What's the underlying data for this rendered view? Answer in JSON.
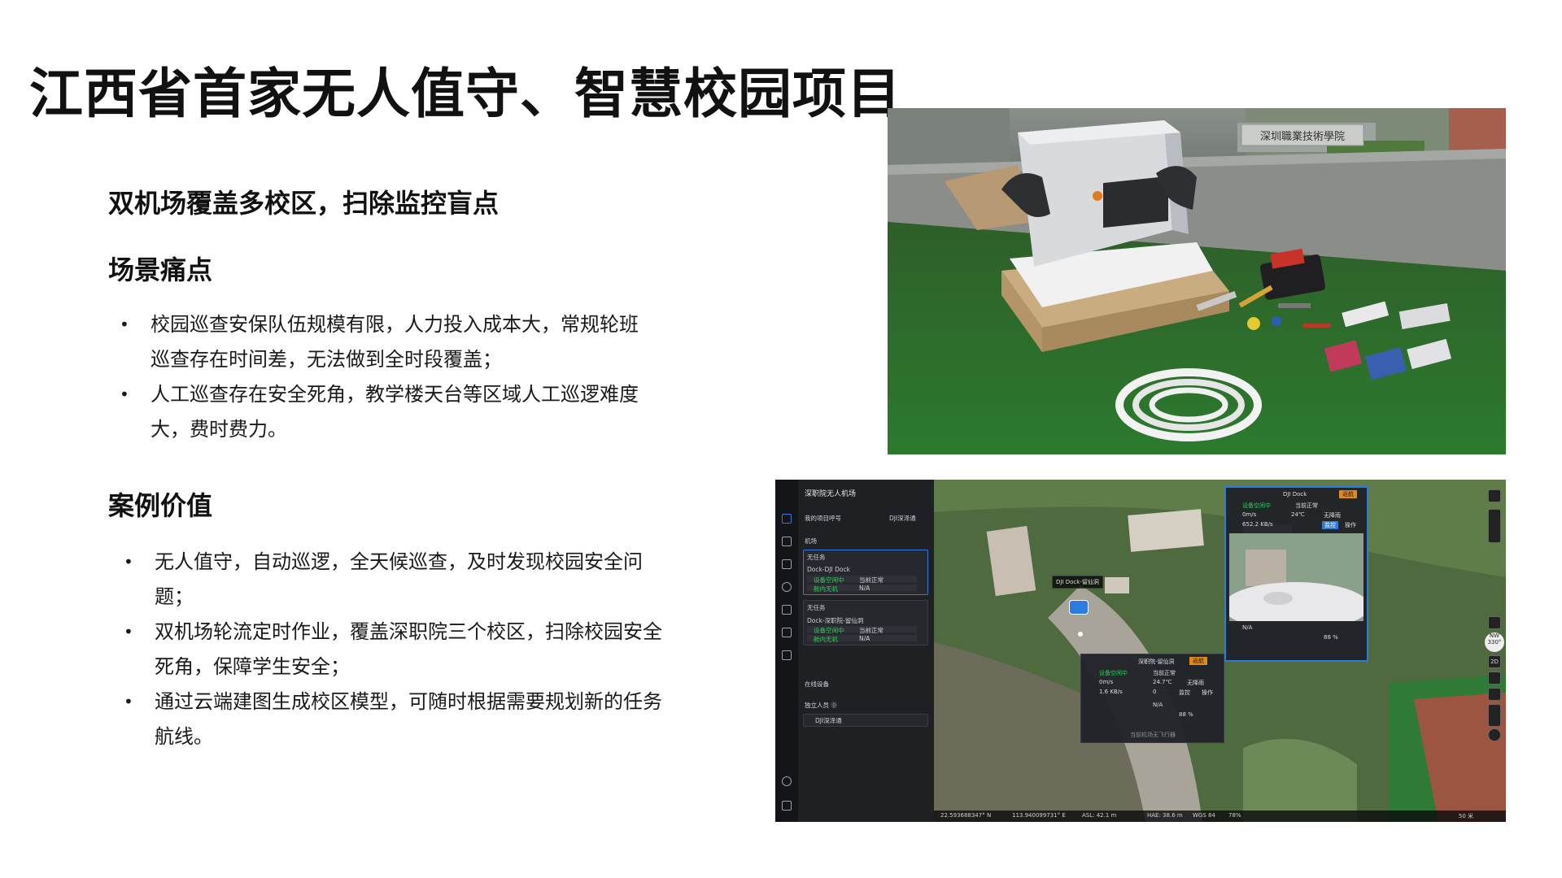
{
  "slide": {
    "title": "江西省首家无人值守、智慧校园项目",
    "subtitle": "双机场覆盖多校区，扫除监控盲点",
    "pain": {
      "heading": "场景痛点",
      "items": [
        "校园巡查安保队伍规模有限，人力投入成本大，常规轮班巡查存在时间差，无法做到全时段覆盖；",
        "人工巡查存在安全死角，教学楼天台等区域人工巡逻难度大，费时费力。"
      ]
    },
    "value": {
      "heading": "案例价值",
      "items": [
        "无人值守，自动巡逻，全天候巡查，及时发现校园安全问题；",
        "双机场轮流定时作业，覆盖深职院三个校区，扫除校园安全死角，保障学生安全；",
        "通过云端建图生成校区模型，可随时根据需要规划新的任务航线。"
      ]
    }
  },
  "photo": {
    "sign_text": "深圳職業技術學院"
  },
  "app": {
    "header": "深职院无人机场",
    "project_label": "我的项目呼号",
    "project_value": "DJI深泽通",
    "dock_section": "机场",
    "dock1": {
      "status": "无任务",
      "name": "Dock-DJI Dock",
      "row1_label": "设备空闲中",
      "row1_value": "当前正常",
      "row2_label": "舱内无机",
      "row2_value": "N/A"
    },
    "dock2": {
      "status": "无任务",
      "name": "Dock-深职院-留仙洞",
      "row1_label": "设备空闲中",
      "row1_value": "当前正常",
      "row2_label": "舱内无机",
      "row2_value": "N/A"
    },
    "online_section": "在线设备",
    "staff_section": "独立人员 ⓪",
    "staff_item": "DJI深泽通",
    "map_tag": "DJI Dock-留仙洞",
    "float_right": {
      "title": "DJI Dock",
      "status": "设备空闲中",
      "state": "当前正常",
      "speed": "0m/s",
      "temp": "24℃",
      "rain": "无降雨",
      "net": "652.2 KB/s",
      "cam": "监控",
      "op": "操作",
      "na": "N/A",
      "battery": "88 %",
      "back": "返航"
    },
    "float_bottom": {
      "title": "深职院-留仙洞",
      "status": "设备空闲中",
      "state": "当前正常",
      "speed": "0m/s",
      "temp": "24.7℃",
      "rain": "无降雨",
      "net": "1.6 KB/s",
      "count": "0",
      "cam": "监控",
      "op": "操作",
      "na": "N/A",
      "battery": "88 %",
      "back": "返航",
      "hint": "当前机场无飞行器"
    },
    "status_bar": {
      "lat": "22.593688347° N",
      "lng": "113.940099731° E",
      "asl": "ASL: 42.1 m",
      "hae": "HAE: 38.6 m",
      "crs": "WGS 84",
      "pct": "78%",
      "scale": "50 米"
    },
    "compass": "NW",
    "compass_deg": "330°",
    "view_2d": "2D"
  },
  "colors": {
    "accent_blue": "#2d7be0",
    "ok_green": "#2ecc5a",
    "warn_orange": "#e08a1e",
    "turf": "#2f6a2c"
  }
}
